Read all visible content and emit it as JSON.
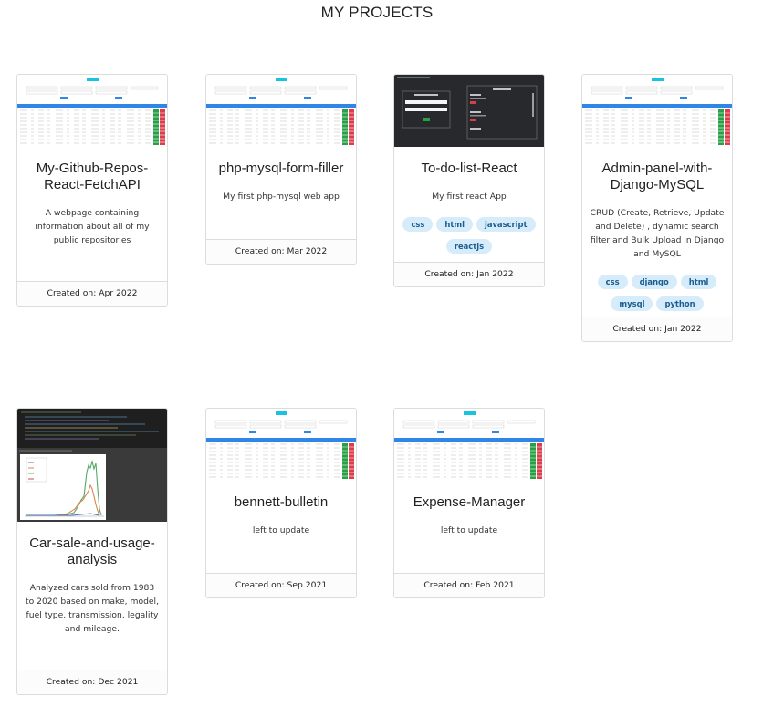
{
  "page": {
    "title": "MY PROJECTS"
  },
  "projects": [
    {
      "name": "My-Github-Repos-React-FetchAPI",
      "description": "A webpage containing information about all of my public repositories",
      "tags": [],
      "created": "Created on: Apr 2022",
      "thumbnail": "table-screenshot"
    },
    {
      "name": "php-mysql-form-filler",
      "description": "My first php-mysql web app",
      "tags": [],
      "created": "Created on: Mar 2022",
      "thumbnail": "table-screenshot"
    },
    {
      "name": "To-do-list-React",
      "description": "My first react App",
      "tags": [
        "css",
        "html",
        "javascript",
        "reactjs"
      ],
      "created": "Created on: Jan 2022",
      "thumbnail": "dark-todo-screenshot"
    },
    {
      "name": "Admin-panel-with-Django-MySQL",
      "description": "CRUD (Create, Retrieve, Update and Delete) , dynamic search filter and Bulk Upload in Django and MySQL",
      "tags": [
        "css",
        "django",
        "html",
        "mysql",
        "python"
      ],
      "created": "Created on: Jan 2022",
      "thumbnail": "table-screenshot"
    },
    {
      "name": "Car-sale-and-usage-analysis",
      "description": "Analyzed cars sold from 1983 to 2020 based on make, model, fuel type, transmission, legality and mileage.",
      "tags": [],
      "created": "Created on: Dec 2021",
      "thumbnail": "notebook-chart-screenshot"
    },
    {
      "name": "bennett-bulletin",
      "description": "left to update",
      "tags": [],
      "created": "Created on: Sep 2021",
      "thumbnail": "table-screenshot"
    },
    {
      "name": "Expense-Manager",
      "description": "left to update",
      "tags": [],
      "created": "Created on: Feb 2021",
      "thumbnail": "table-screenshot"
    }
  ]
}
